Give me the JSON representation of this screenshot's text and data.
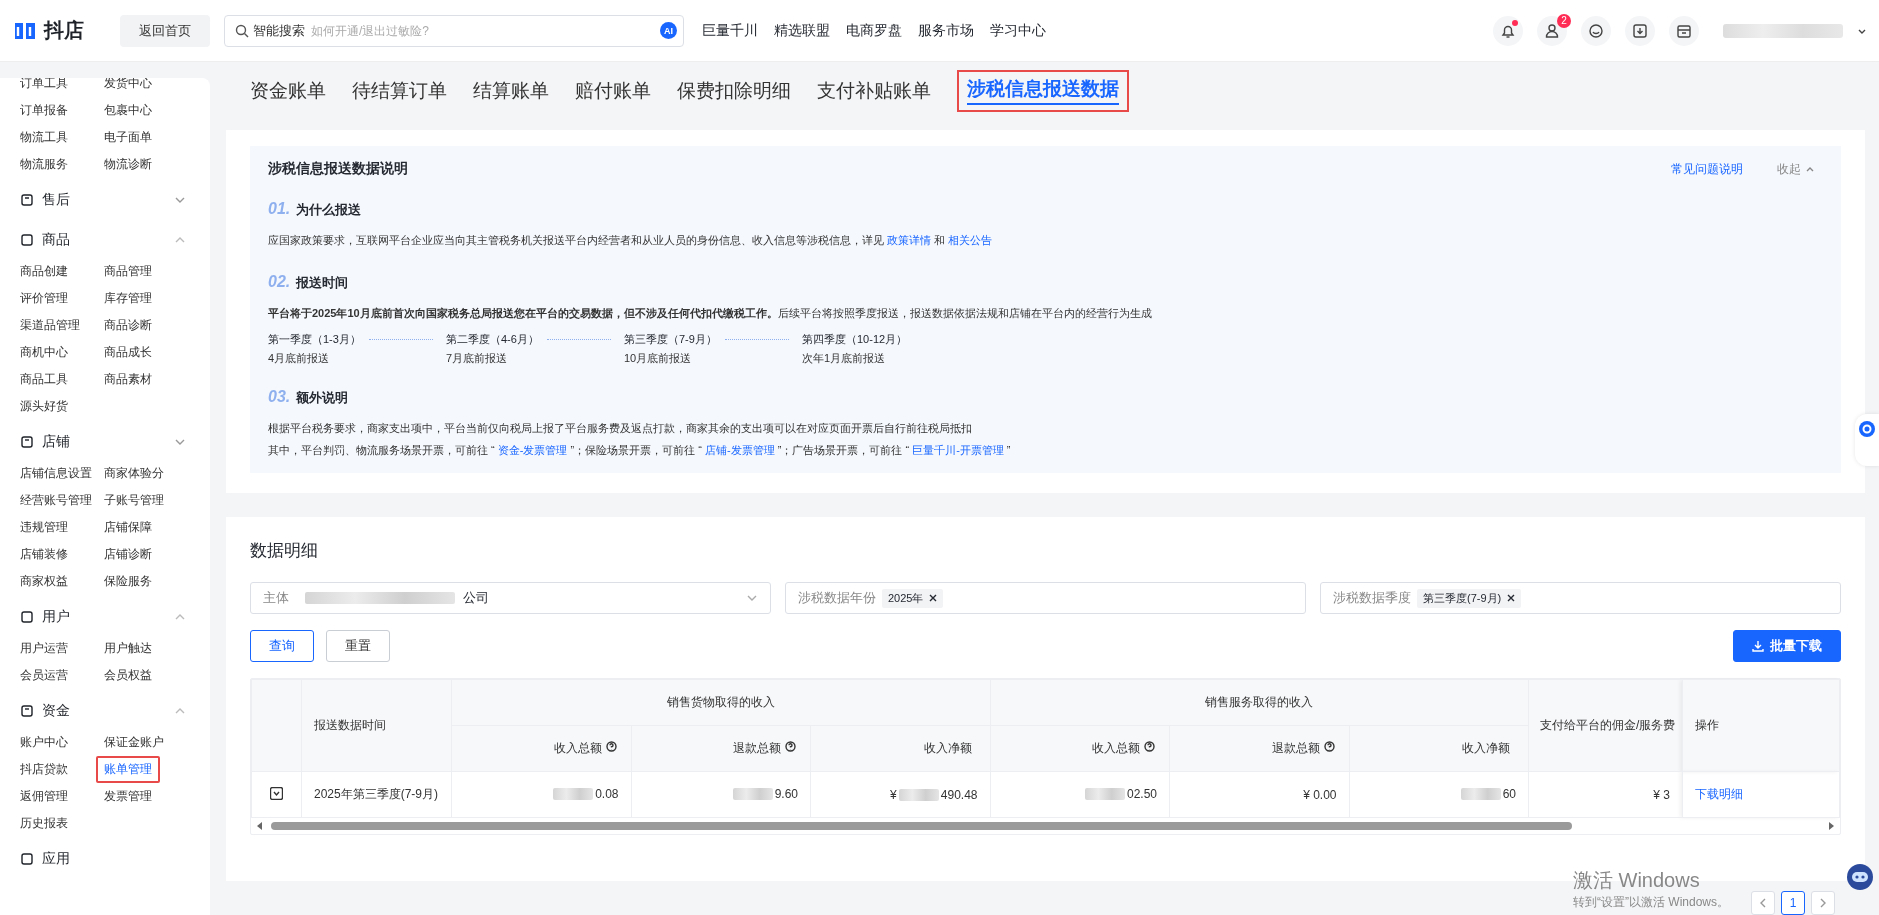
{
  "header": {
    "logo_text": "抖店",
    "home_button": "返回首页",
    "search": {
      "label": "智能搜索",
      "placeholder": "如何开通/退出过敏险?",
      "ai_badge": "AI"
    },
    "nav": [
      "巨量千川",
      "精选联盟",
      "电商罗盘",
      "服务市场",
      "学习中心"
    ],
    "notification_dot": true,
    "user_badge": "2"
  },
  "sidebar": [
    {
      "items": [
        {
          "label": "订单工具",
          "selected": false
        },
        {
          "label": "发货中心",
          "selected": false
        },
        {
          "label": "订单报备",
          "selected": false
        },
        {
          "label": "包裹中心",
          "selected": false
        },
        {
          "label": "物流工具",
          "selected": false
        },
        {
          "label": "电子面单",
          "selected": false
        },
        {
          "label": "物流服务",
          "selected": false
        },
        {
          "label": "物流诊断",
          "selected": false
        }
      ]
    },
    {
      "title": "售后",
      "expanded": false
    },
    {
      "title": "商品",
      "expanded": true,
      "items": [
        {
          "label": "商品创建",
          "selected": false
        },
        {
          "label": "商品管理",
          "selected": false
        },
        {
          "label": "评价管理",
          "selected": false
        },
        {
          "label": "库存管理",
          "selected": false
        },
        {
          "label": "渠道品管理",
          "selected": false
        },
        {
          "label": "商品诊断",
          "selected": false
        },
        {
          "label": "商机中心",
          "selected": false
        },
        {
          "label": "商品成长",
          "selected": false
        },
        {
          "label": "商品工具",
          "selected": false
        },
        {
          "label": "商品素材",
          "selected": false
        },
        {
          "label": "源头好货",
          "selected": false
        }
      ]
    },
    {
      "title": "店铺",
      "expanded": false,
      "items": [
        {
          "label": "店铺信息设置",
          "selected": false
        },
        {
          "label": "商家体验分",
          "selected": false
        },
        {
          "label": "经营账号管理",
          "selected": false
        },
        {
          "label": "子账号管理",
          "selected": false
        },
        {
          "label": "违规管理",
          "selected": false
        },
        {
          "label": "店铺保障",
          "selected": false
        },
        {
          "label": "店铺装修",
          "selected": false
        },
        {
          "label": "店铺诊断",
          "selected": false
        },
        {
          "label": "商家权益",
          "selected": false
        },
        {
          "label": "保险服务",
          "selected": false
        }
      ]
    },
    {
      "title": "用户",
      "expanded": true,
      "items": [
        {
          "label": "用户运营",
          "selected": false
        },
        {
          "label": "用户触达",
          "selected": false
        },
        {
          "label": "会员运营",
          "selected": false
        },
        {
          "label": "会员权益",
          "selected": false
        }
      ]
    },
    {
      "title": "资金",
      "expanded": true,
      "items": [
        {
          "label": "账户中心",
          "selected": false
        },
        {
          "label": "保证金账户",
          "selected": false
        },
        {
          "label": "抖店贷款",
          "selected": false
        },
        {
          "label": "账单管理",
          "selected": true
        },
        {
          "label": "返佣管理",
          "selected": false
        },
        {
          "label": "发票管理",
          "selected": false
        },
        {
          "label": "历史报表",
          "selected": false
        }
      ]
    },
    {
      "title": "应用"
    }
  ],
  "tabs": [
    {
      "label": "资金账单",
      "selected": false
    },
    {
      "label": "待结算订单",
      "selected": false
    },
    {
      "label": "结算账单",
      "selected": false
    },
    {
      "label": "赔付账单",
      "selected": false
    },
    {
      "label": "保费扣除明细",
      "selected": false
    },
    {
      "label": "支付补贴账单",
      "selected": false
    },
    {
      "label": "涉税信息报送数据",
      "selected": true
    }
  ],
  "explanation": {
    "title": "涉税信息报送数据说明",
    "faq_link": "常见问题说明",
    "collapse": "收起",
    "sections": [
      {
        "number": "01.",
        "title": "为什么报送",
        "lines": [
          [
            {
              "text": "应国家政策要求，互联网平台企业应当向其主管税务机关报送平台内经营者和从业人员的身份信息、收入信息等涉税信息，详见 "
            },
            {
              "link": "政策详情"
            },
            {
              "text": " 和 "
            },
            {
              "link": "相关公告"
            }
          ]
        ]
      },
      {
        "number": "02.",
        "title": "报送时间",
        "lines": [
          [
            {
              "text": "**平台将于2025年10月底前首次向国家税务总局报送您在平台的交易数据，但不涉及任何代扣代缴税工作。**后续平台将按照季度报送，报送数据依据法规和店铺在平台内的经营行为生成"
            }
          ]
        ],
        "quarters": [
          {
            "name": "第一季度（1-3月）",
            "due": "4月底前报送"
          },
          {
            "name": "第二季度（4-6月）",
            "due": "7月底前报送"
          },
          {
            "name": "第三季度（7-9月）",
            "due": "10月底前报送"
          },
          {
            "name": "第四季度（10-12月）",
            "due": "次年1月底前报送"
          }
        ]
      },
      {
        "number": "03.",
        "title": "额外说明",
        "lines": [
          [
            {
              "text": "根据平台税务要求，商家支出项中，平台当前仅向税局上报了平台服务费及返点打款，商家其余的支出项可以在对应页面开票后自行前往税局抵扣"
            }
          ],
          [
            {
              "text": "其中，平台判罚、物流服务场景开票，可前往 “ "
            },
            {
              "link": "资金-发票管理"
            },
            {
              "text": " ”；保险场景开票，可前往 “ "
            },
            {
              "link": "店铺-发票管理"
            },
            {
              "text": " ”；广告场景开票，可前往 “ "
            },
            {
              "link": "巨量千川-开票管理"
            },
            {
              "text": " ”"
            }
          ]
        ]
      }
    ]
  },
  "details": {
    "title": "数据明细",
    "filters": [
      {
        "kind": "select",
        "label": "主体",
        "value": "公司"
      },
      {
        "kind": "tags",
        "label": "涉税数据年份",
        "tags": [
          "2025年"
        ]
      },
      {
        "kind": "tags",
        "label": "涉税数据季度",
        "tags": [
          "第三季度(7-9月)"
        ]
      }
    ],
    "query_button": "查询",
    "reset_button": "重置",
    "download_button": "批量下载",
    "table": {
      "time_header": "报送数据时间",
      "groups": [
        {
          "title": "销售货物取得的收入",
          "columns": [
            {
              "label": "收入总额",
              "help": true
            },
            {
              "label": "退款总额",
              "help": true
            },
            {
              "label": "收入净额",
              "help": false
            }
          ]
        },
        {
          "title": "销售服务取得的收入",
          "columns": [
            {
              "label": "收入总额",
              "help": true
            },
            {
              "label": "退款总额",
              "help": true
            },
            {
              "label": "收入净额",
              "help": false
            }
          ]
        }
      ],
      "commission_header": "支付给平台的佣金/服务费",
      "action_header": "操作",
      "rows": [
        {
          "expanded": false,
          "time": "2025年第三季度(7-9月)",
          "cells": [
            {
              "blurred": true,
              "text": "0.08"
            },
            {
              "blurred": true,
              "text": "9.60"
            },
            {
              "blurred": true,
              "text": "¥",
              "tail": "490.48"
            },
            {
              "blurred": true,
              "text": "02.50"
            },
            {
              "blurred": false,
              "text": "¥ 0.00"
            },
            {
              "blurred": true,
              "text": "60"
            },
            {
              "blurred": false,
              "text": "¥ 3"
            }
          ],
          "action": "下载明细"
        }
      ]
    }
  },
  "pagination": {
    "pages": [
      {
        "label": "1",
        "selected": true
      }
    ]
  },
  "os_notice": {
    "title": "激活 Windows",
    "subtitle": "转到“设置”以激活 Windows。"
  }
}
